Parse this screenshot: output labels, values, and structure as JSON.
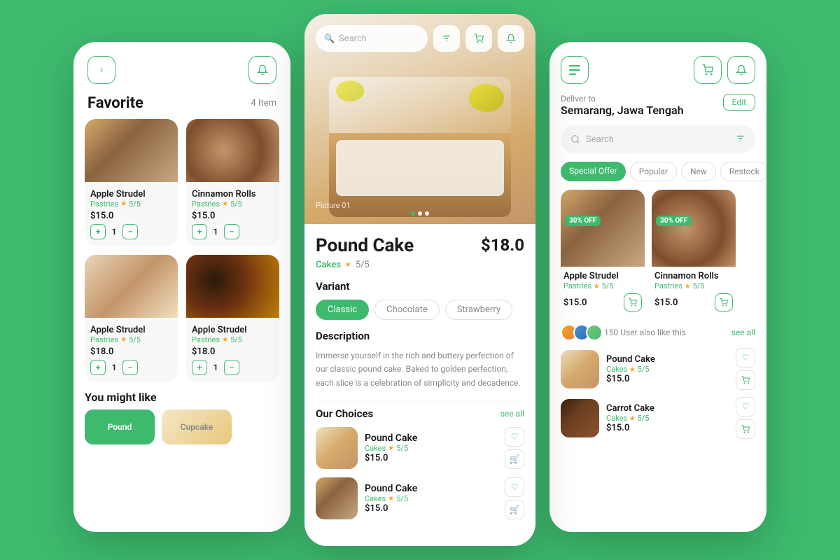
{
  "left_screen": {
    "back_label": "‹",
    "notification_icon": "🔔",
    "title": "Favorite",
    "item_count": "4 Item",
    "products": [
      {
        "name": "Apple Strudel",
        "category": "Pastries",
        "rating": "5/5",
        "price": "$15.0",
        "qty": "1",
        "img_class": "img-bg-1"
      },
      {
        "name": "Cinnamon Rolls",
        "category": "Pastries",
        "rating": "5/5",
        "price": "$15.0",
        "qty": "1",
        "img_class": "img-bg-2"
      },
      {
        "name": "Apple Strudel",
        "category": "Pastries",
        "rating": "5/5",
        "price": "$18.0",
        "qty": "1",
        "img_class": "img-bg-3"
      },
      {
        "name": "Apple Strudel",
        "category": "Pastries",
        "rating": "5/5",
        "price": "$18.0",
        "qty": "1",
        "img_class": "img-bg-4"
      }
    ],
    "you_might": "You might like",
    "mini_cards": [
      "Pound",
      "Cupcake"
    ]
  },
  "middle_screen": {
    "search_placeholder": "Search",
    "product_name": "Pound Cake",
    "product_price": "$18.0",
    "category": "Cakes",
    "rating": "5/5",
    "variant_label": "Variant",
    "variants": [
      "Classic",
      "Chocolate",
      "Strawberry"
    ],
    "active_variant": "Classic",
    "description_label": "Description",
    "description": "Immerse yourself in the rich and buttery perfection of our classic pound cake. Baked to golden perfection, each slice is a celebration of simplicity and decadence.",
    "our_choices_label": "Our Choices",
    "see_all": "see all",
    "choices": [
      {
        "name": "Pound Cake",
        "category": "Cakes",
        "rating": "5/5",
        "price": "$15.0"
      },
      {
        "name": "Pound Cake",
        "category": "Cakes",
        "rating": "5/5",
        "price": "$15.0"
      }
    ],
    "pic_label": "Picture 01"
  },
  "right_screen": {
    "deliver_to": "Deliver to",
    "address": "Semarang, Jawa Tengah",
    "edit_label": "Edit",
    "search_placeholder": "Search",
    "filter_chips": [
      "Special Offer",
      "Popular",
      "New",
      "Restock"
    ],
    "active_chip": "Special Offer",
    "products": [
      {
        "name": "Apple Strudel",
        "category": "Pastries",
        "rating": "5/5",
        "price": "$15.0",
        "discount": "30% OFF",
        "img_class": "img-bg-1"
      },
      {
        "name": "Cinnamon Rolls",
        "category": "Pastries",
        "rating": "5/5",
        "price": "$15.0",
        "discount": "30% OFF",
        "img_class": "img-bg-2"
      }
    ],
    "users_count": "150",
    "users_like_text": "User also like this",
    "see_all": "see all",
    "liked_items": [
      {
        "name": "Pound Cake",
        "category": "Cakes",
        "rating": "5/5",
        "price": "$15.0",
        "img_class": "img-bg-pound"
      },
      {
        "name": "Carrot Cake",
        "category": "Cakes",
        "rating": "5/5",
        "price": "$15.0",
        "img_class": "img-bg-carrot"
      }
    ]
  }
}
